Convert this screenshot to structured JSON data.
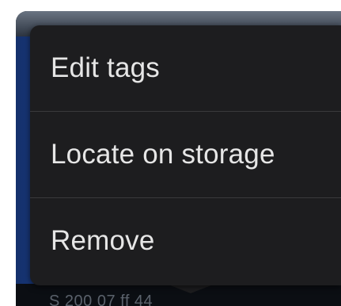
{
  "menu": {
    "items": [
      {
        "label": "Edit tags"
      },
      {
        "label": "Locate on storage"
      },
      {
        "label": "Remove"
      }
    ]
  },
  "background": {
    "bottom_text": "S 200 07 ff 44"
  },
  "colors": {
    "menu_bg": "#1d1d1f",
    "menu_text": "#e6e6e6",
    "divider": "#3a3a3c"
  }
}
